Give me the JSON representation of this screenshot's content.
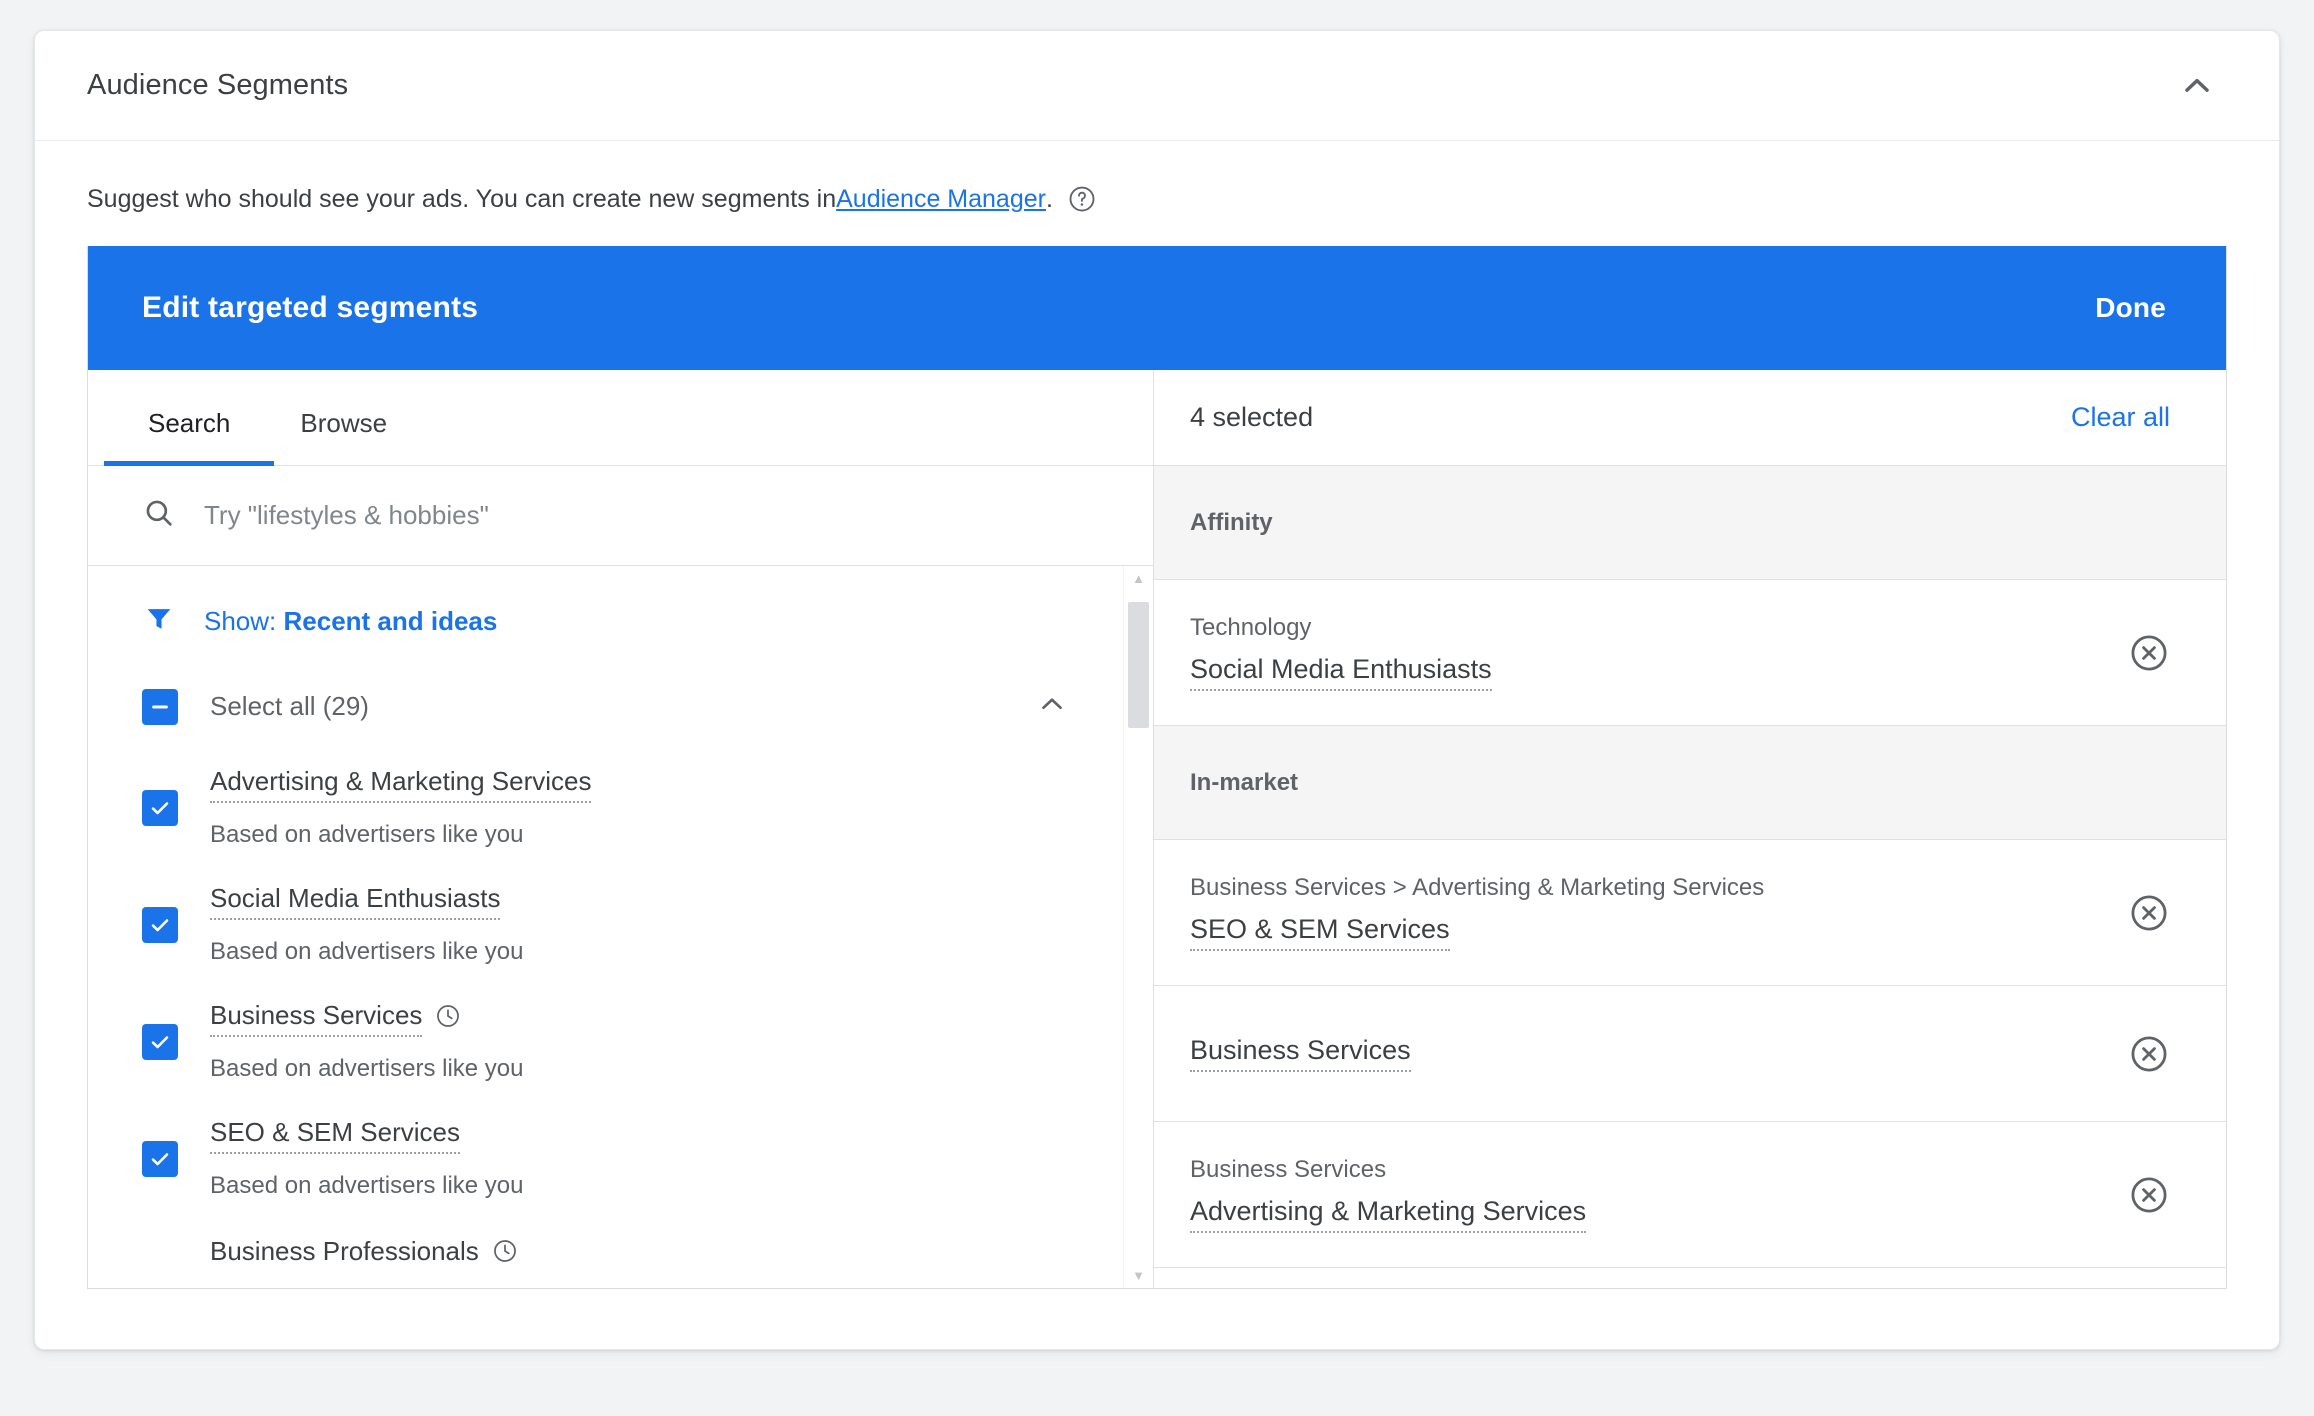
{
  "card": {
    "title": "Audience Segments",
    "collapse_icon": "chevron-up-icon",
    "description_prefix": "Suggest who should see your ads.  You can create new segments in ",
    "description_link": "Audience Manager",
    "description_suffix": ".",
    "help_icon": "help-circle-icon"
  },
  "dialog": {
    "title": "Edit targeted segments",
    "done_label": "Done",
    "accent_color": "#1a73e8"
  },
  "left_pane": {
    "tabs": [
      {
        "label": "Search",
        "active": true
      },
      {
        "label": "Browse",
        "active": false
      }
    ],
    "search": {
      "placeholder": "Try \"lifestyles & hobbies\"",
      "value": "",
      "icon": "search-icon"
    },
    "filter": {
      "icon": "filter-funnel-icon",
      "prefix": "Show: ",
      "value": "Recent and ideas"
    },
    "select_all": {
      "label": "Select all (29)",
      "state": "indeterminate",
      "collapse_icon": "chevron-up-icon"
    },
    "items": [
      {
        "name": "Advertising & Marketing Services",
        "subtitle": "Based on advertisers like you",
        "checked": true,
        "recent": false
      },
      {
        "name": "Social Media Enthusiasts",
        "subtitle": "Based on advertisers like you",
        "checked": true,
        "recent": false
      },
      {
        "name": "Business Services",
        "subtitle": "Based on advertisers like you",
        "checked": true,
        "recent": true
      },
      {
        "name": "SEO & SEM Services",
        "subtitle": "Based on advertisers like you",
        "checked": true,
        "recent": true
      },
      {
        "name": "Business Professionals",
        "subtitle": "",
        "checked": false,
        "recent": true
      }
    ]
  },
  "right_pane": {
    "selected_count_label": "4 selected",
    "clear_all_label": "Clear all",
    "groups": [
      {
        "label": "Affinity",
        "rows": [
          {
            "breadcrumb": "Technology",
            "name": "Social Media Enthusiasts",
            "remove_icon": "remove-circle-icon"
          }
        ]
      },
      {
        "label": "In-market",
        "rows": [
          {
            "breadcrumb": "Business Services > Advertising & Marketing Services",
            "name": "SEO & SEM Services",
            "remove_icon": "remove-circle-icon"
          },
          {
            "breadcrumb": "",
            "name": "Business Services",
            "remove_icon": "remove-circle-icon"
          },
          {
            "breadcrumb": "Business Services",
            "name": "Advertising & Marketing Services",
            "remove_icon": "remove-circle-icon"
          }
        ]
      }
    ]
  }
}
